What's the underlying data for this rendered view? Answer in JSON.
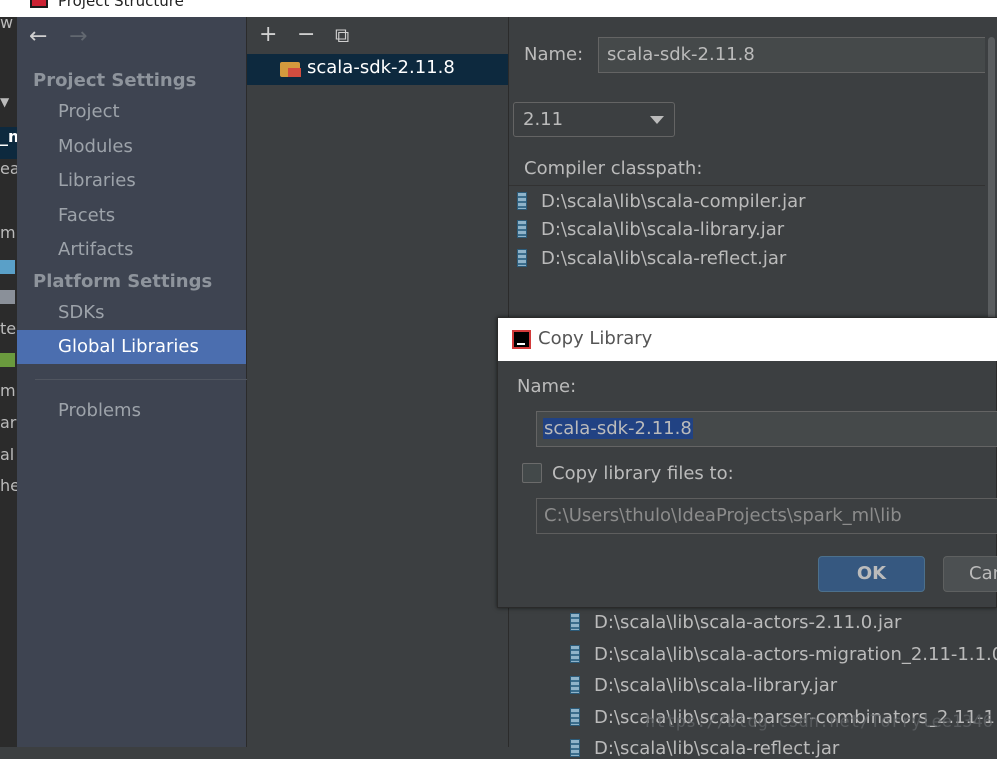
{
  "window": {
    "title": "Project Structure"
  },
  "edge_fragments": [
    "w",
    "_m",
    "ea",
    "m",
    "te",
    "m.",
    "ark",
    "al",
    "he"
  ],
  "sidebar": {
    "project_settings": "Project Settings",
    "project_items": [
      "Project",
      "Modules",
      "Libraries",
      "Facets",
      "Artifacts"
    ],
    "platform_settings": "Platform Settings",
    "platform_items": [
      "SDKs",
      "Global Libraries"
    ],
    "problems": "Problems",
    "selected": "Global Libraries"
  },
  "toolbar": {
    "add": "+",
    "remove": "−",
    "copy": "⧉"
  },
  "library_list": {
    "items": [
      "scala-sdk-2.11.8"
    ]
  },
  "detail": {
    "name_label": "Name:",
    "name_value": "scala-sdk-2.11.8",
    "version": "2.11",
    "classpath_label": "Compiler classpath:",
    "classpath": [
      "D:\\scala\\lib\\scala-compiler.jar",
      "D:\\scala\\lib\\scala-library.jar",
      "D:\\scala\\lib\\scala-reflect.jar"
    ],
    "library_jars": [
      "D:\\scala\\lib\\scala-actors-2.11.0.jar",
      "D:\\scala\\lib\\scala-actors-migration_2.11-1.1.0",
      "D:\\scala\\lib\\scala-library.jar",
      "D:\\scala\\lib\\scala-parser-combinators_2.11-1",
      "D:\\scala\\lib\\scala-reflect.jar"
    ]
  },
  "dialog": {
    "title": "Copy Library",
    "name_label": "Name:",
    "name_value": "scala-sdk-2.11.8",
    "copy_label": "Copy library files to:",
    "copy_checked": false,
    "path_value": "C:\\Users\\thulo\\IdeaProjects\\spark_ml\\lib",
    "ok_label": "OK",
    "cancel_label": "Cancel"
  },
  "watermark": "https://blog.csdn.net/Torrylee1346"
}
